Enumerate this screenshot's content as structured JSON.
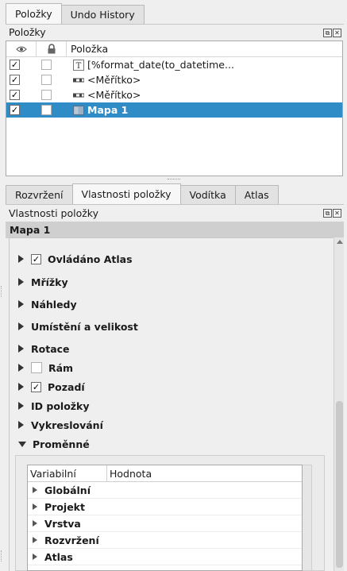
{
  "top_tabs": [
    {
      "label": "Položky",
      "active": true
    },
    {
      "label": "Undo History",
      "active": false
    }
  ],
  "items_dock": {
    "title": "Položky",
    "columns": {
      "visibility": "eye-icon",
      "lock": "lock-icon",
      "item": "Položka"
    },
    "rows": [
      {
        "visible": true,
        "locked": false,
        "icon": "text-icon",
        "label": "[%format_date(to_datetime...",
        "selected": false
      },
      {
        "visible": true,
        "locked": false,
        "icon": "scalebar-icon",
        "label": "<Měřítko>",
        "selected": false
      },
      {
        "visible": true,
        "locked": false,
        "icon": "scalebar-icon",
        "label": "<Měřítko>",
        "selected": false
      },
      {
        "visible": true,
        "locked": false,
        "icon": "map-icon",
        "label": "Mapa 1",
        "selected": true
      }
    ]
  },
  "bottom_tabs": [
    {
      "label": "Rozvržení",
      "active": false
    },
    {
      "label": "Vlastnosti položky",
      "active": true
    },
    {
      "label": "Vodítka",
      "active": false
    },
    {
      "label": "Atlas",
      "active": false
    }
  ],
  "props_dock": {
    "title": "Vlastnosti položky",
    "item_name": "Mapa 1",
    "groups": [
      {
        "label": "Ovládáno Atlas",
        "checkbox": true,
        "checked": true
      },
      {
        "label": "Mřížky",
        "checkbox": false
      },
      {
        "label": "Náhledy",
        "checkbox": false
      },
      {
        "label": "Umístění a velikost",
        "checkbox": false
      },
      {
        "label": "Rotace",
        "checkbox": false
      },
      {
        "label": "Rám",
        "checkbox": true,
        "checked": false
      },
      {
        "label": "Pozadí",
        "checkbox": true,
        "checked": true
      },
      {
        "label": "ID položky",
        "checkbox": false
      },
      {
        "label": "Vykreslování",
        "checkbox": false
      },
      {
        "label": "Proměnné",
        "checkbox": false,
        "expanded": true
      }
    ],
    "variables": {
      "headers": [
        "Variabilní",
        "Hodnota"
      ],
      "rows": [
        "Globální",
        "Projekt",
        "Vrstva",
        "Rozvržení",
        "Atlas"
      ]
    }
  },
  "colors": {
    "selection": "#308cc6",
    "header": "#cfcfcf"
  }
}
